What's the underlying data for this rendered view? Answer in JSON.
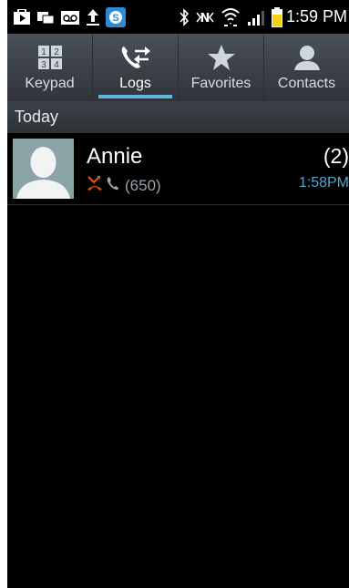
{
  "status_bar": {
    "time": "1:59 PM",
    "left_icons": [
      "play-store-icon",
      "messages-icon",
      "voicemail-icon",
      "upload-icon",
      "skype-icon"
    ],
    "right_icons": [
      "bluetooth-icon",
      "nfc-icon",
      "wifi-icon",
      "signal-icon",
      "battery-icon"
    ]
  },
  "tabs": [
    {
      "label": "Keypad",
      "icon": "keypad-icon",
      "active": false
    },
    {
      "label": "Logs",
      "icon": "logs-icon",
      "active": true
    },
    {
      "label": "Favorites",
      "icon": "star-icon",
      "active": false
    },
    {
      "label": "Contacts",
      "icon": "person-icon",
      "active": false
    }
  ],
  "section": {
    "label": "Today"
  },
  "logs": [
    {
      "name": "Annie",
      "number": "(650)",
      "count": "(2)",
      "time": "1:58PM",
      "call_type_icons": [
        "missed-call-icon",
        "phone-icon"
      ]
    }
  ],
  "colors": {
    "accent": "#5fb7de",
    "time_text": "#4fa6d6",
    "missed_call": "#e8541c",
    "battery": "#f5d313"
  }
}
